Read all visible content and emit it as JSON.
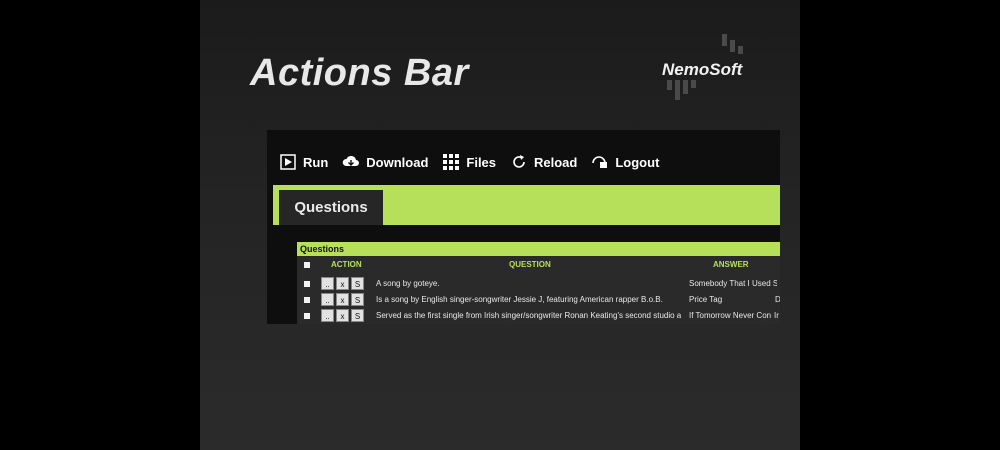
{
  "slide": {
    "title": "Actions Bar",
    "logo_text": "NemoSoft"
  },
  "toolbar": {
    "items": [
      {
        "label": "Run",
        "icon": "play-icon"
      },
      {
        "label": "Download",
        "icon": "cloud-download-icon"
      },
      {
        "label": "Files",
        "icon": "grid-icon"
      },
      {
        "label": "Reload",
        "icon": "reload-icon"
      },
      {
        "label": "Logout",
        "icon": "logout-icon"
      }
    ]
  },
  "tabs": {
    "active": "Questions"
  },
  "table": {
    "title": "Questions",
    "columns": [
      "ACTION",
      "QUESTION",
      "ANSWER"
    ],
    "action_buttons": [
      "..",
      "x",
      "S"
    ],
    "rows": [
      {
        "question": "A song by goteye.",
        "answer": "Somebody That I Used S",
        "extra": ""
      },
      {
        "question": "Is a song by English singer-songwriter Jessie J, featuring American rapper B.o.B.",
        "answer": "Price Tag",
        "extra": "D"
      },
      {
        "question": "Served as the first single from Irish singer/songwriter Ronan Keating's second studio a",
        "answer": "If Tomorrow Never Con",
        "extra": "Ir"
      }
    ]
  },
  "colors": {
    "accent": "#b6e05a",
    "background": "#0e0e0e"
  }
}
